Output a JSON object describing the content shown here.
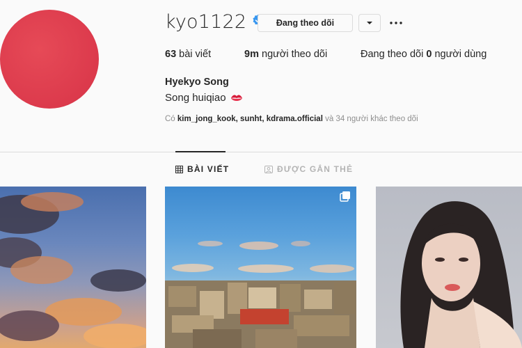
{
  "profile": {
    "username": "kyo1122",
    "follow_label": "Đang theo dõi",
    "full_name": "Hyekyo Song",
    "bio": "Song huiqiao",
    "avatar_color": "#dc3a4c"
  },
  "stats": {
    "posts_count": "63",
    "posts_label": "bài viết",
    "followers_count": "9m",
    "followers_label": "người theo dõi",
    "following_prefix": "Đang theo dõi",
    "following_count": "0",
    "following_label": "người dùng"
  },
  "followed_by": {
    "prefix": "Có",
    "user1": "kim_jong_kook,",
    "user2": "sunht,",
    "user3": "kdrama.official",
    "suffix": "và 34 người khác theo dõi"
  },
  "tabs": {
    "posts_label": "BÀI VIẾT",
    "tagged_label": "ĐƯỢC GẮN THẺ"
  },
  "colors": {
    "verified": "#3897f0",
    "text": "#262626",
    "muted": "#8e8e8e",
    "border": "#dbdbdb"
  },
  "icons": {
    "verified": "verified-badge-icon",
    "dropdown": "chevron-down-icon",
    "more": "more-options-icon",
    "grid": "grid-icon",
    "tagged": "tagged-icon",
    "multi": "multiple-photos-icon",
    "bio_emoji": "kiss-mark-icon"
  }
}
